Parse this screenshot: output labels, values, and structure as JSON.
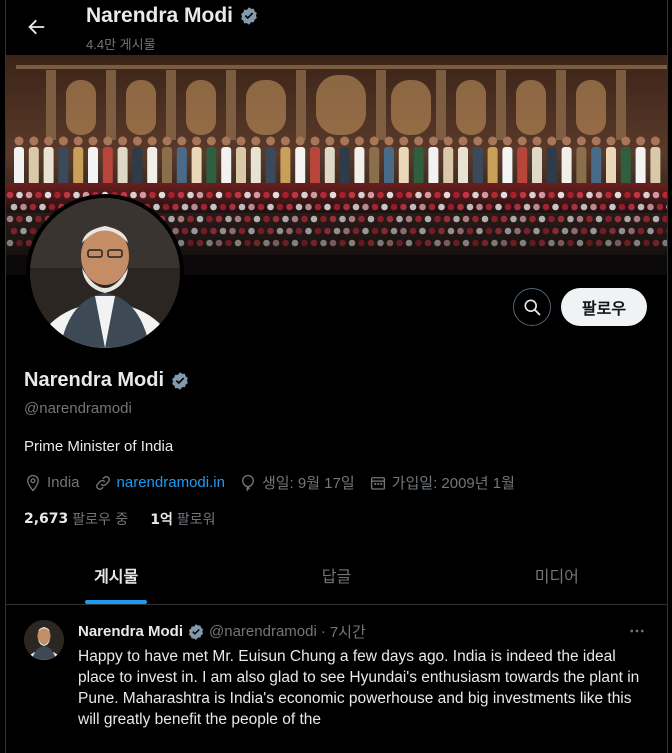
{
  "header": {
    "name": "Narendra Modi",
    "post_count": "4.4만 게시물"
  },
  "actions": {
    "follow_label": "팔로우"
  },
  "profile": {
    "name": "Narendra Modi",
    "handle": "@narendramodi",
    "bio": "Prime Minister of India",
    "location": "India",
    "website": "narendramodi.in",
    "birthday": "생일: 9월 17일",
    "joined": "가입일: 2009년 1월",
    "following_count": "2,673",
    "following_label": "팔로우 중",
    "followers_count": "1억",
    "followers_label": "팔로워"
  },
  "tabs": [
    {
      "label": "게시물",
      "active": true
    },
    {
      "label": "답글",
      "active": false
    },
    {
      "label": "미디어",
      "active": false
    }
  ],
  "tweet": {
    "name": "Narendra Modi",
    "handle": "@narendramodi",
    "separator": "·",
    "time": "7시간",
    "text": "Happy to have met Mr. Euisun Chung a few days ago. India is indeed the ideal place to invest in. I am also glad to see Hyundai's enthusiasm towards the plant in Pune. Maharashtra is India's economic powerhouse and big investments like this will greatly benefit the people of the"
  },
  "colors": {
    "background": "#000000",
    "accent": "#1d9bf0",
    "text_primary": "#e7e9ea",
    "text_secondary": "#71767b",
    "follow_button_bg": "#eff3f4"
  }
}
